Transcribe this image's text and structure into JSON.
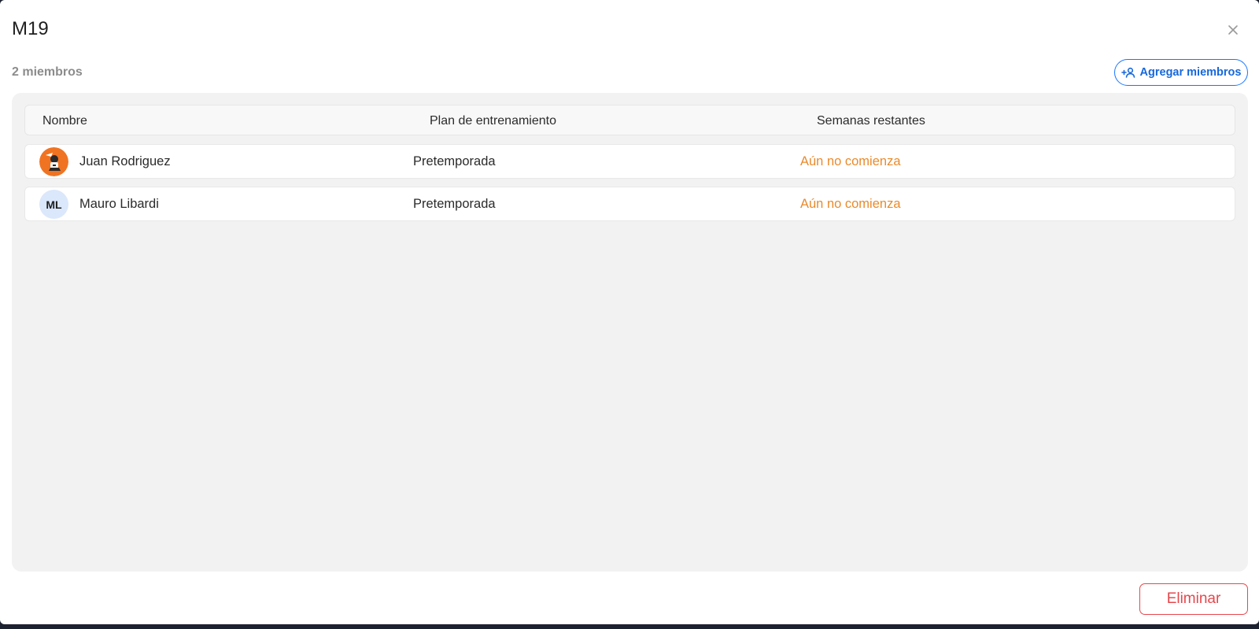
{
  "modal": {
    "title": "M19",
    "close_icon": "close-icon"
  },
  "members": {
    "count_label": "2 miembros",
    "add_button_label": "Agregar miembros",
    "add_icon": "add-person-icon"
  },
  "table": {
    "columns": [
      "Nombre",
      "Plan de entrenamiento",
      "Semanas restantes"
    ],
    "rows": [
      {
        "name": "Juan Rodriguez",
        "avatar": "photo",
        "plan": "Pretemporada",
        "weeks_remaining": "Aún no comienza"
      },
      {
        "name": "Mauro Libardi",
        "avatar_initials": "ML",
        "plan": "Pretemporada",
        "weeks_remaining": "Aún no comienza"
      }
    ]
  },
  "footer": {
    "delete_button_label": "Eliminar"
  },
  "colors": {
    "accent": "#1677ff",
    "status_pending": "#ea8a2a",
    "danger": "#e5484d",
    "avatar_orange": "#f07322"
  }
}
